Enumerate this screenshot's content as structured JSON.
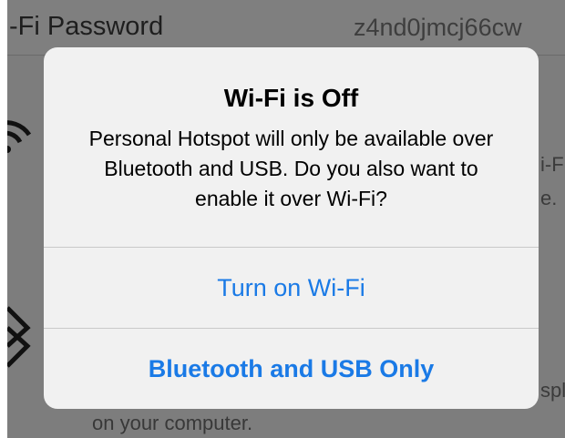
{
  "background": {
    "header_label": "-Fi Password",
    "header_value": "z4nd0jmcj66cw",
    "side_text_1": "i-F",
    "side_text_2": "e.",
    "side_text_3": "spla",
    "footer_text": "on your computer.",
    "icons": [
      "wifi-icon",
      "bluetooth-icon"
    ]
  },
  "alert": {
    "title": "Wi-Fi is Off",
    "message": "Personal Hotspot will only be available over Bluetooth and USB. Do you also want to enable it over Wi-Fi?",
    "buttons": [
      {
        "label": "Turn on Wi-Fi"
      },
      {
        "label": "Bluetooth and USB Only"
      }
    ],
    "accent_color": "#1a7ae6"
  }
}
